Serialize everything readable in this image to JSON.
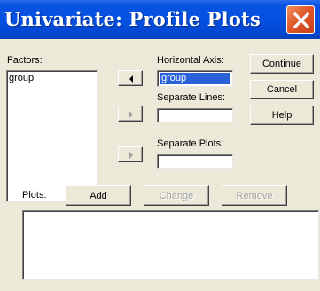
{
  "window": {
    "title": "Univariate: Profile Plots",
    "close_icon": "close-icon"
  },
  "factors": {
    "label": "Factors:",
    "items": [
      "group"
    ]
  },
  "horizontal_axis": {
    "label": "Horizontal Axis:",
    "value": "group"
  },
  "separate_lines": {
    "label": "Separate Lines:",
    "value": ""
  },
  "separate_plots": {
    "label": "Separate Plots:",
    "value": ""
  },
  "buttons": {
    "continue": "Continue",
    "cancel": "Cancel",
    "help": "Help"
  },
  "plots": {
    "label": "Plots:",
    "add": "Add",
    "change": "Change",
    "remove": "Remove",
    "items": []
  },
  "icons": {
    "move_left": "arrow-left-icon",
    "move_right": "arrow-right-icon"
  },
  "colors": {
    "titlebar": "#0451E2",
    "dialog_bg": "#ECE9D8",
    "selection": "#2A60D8",
    "close_button": "#E05A2A"
  }
}
